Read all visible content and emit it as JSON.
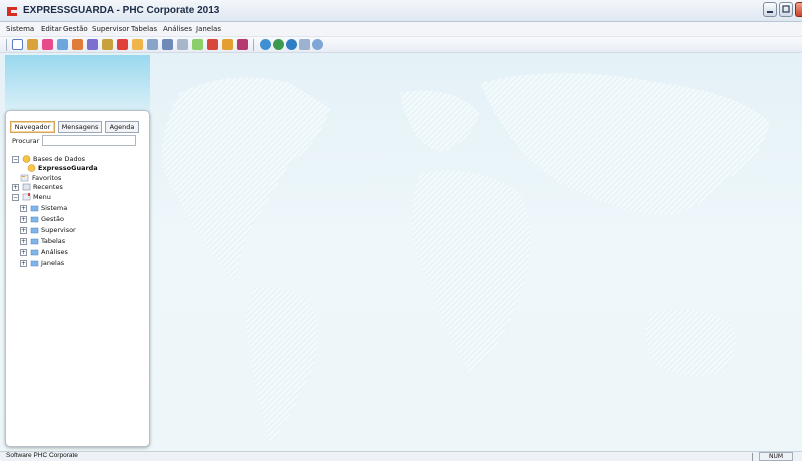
{
  "window": {
    "title": "EXPRESSGUARDA - PHC Corporate 2013",
    "logo_icon": "phc-logo-icon",
    "controls": [
      "minimize-icon",
      "maximize-icon",
      "close-icon"
    ]
  },
  "menubar": {
    "items": [
      "Sistema",
      "Editar",
      "Gestão",
      "Supervisor",
      "Tabelas",
      "Análises",
      "Janelas"
    ]
  },
  "toolbar": {
    "icons": [
      "new-doc-icon",
      "users-icon",
      "calendar-icon",
      "arrow-icon",
      "chart-icon",
      "notes-icon",
      "users-icon",
      "calendar-red-icon",
      "arrow-icon",
      "table-icon",
      "grid-icon",
      "list-icon",
      "check-icon",
      "folder-icon",
      "people-icon",
      "tools-icon",
      "globe-icon",
      "globe-icon",
      "globe-icon",
      "document-icon",
      "help-icon"
    ]
  },
  "navigator": {
    "tabs": [
      "Navegador",
      "Mensagens",
      "Agenda"
    ],
    "search_label": "Procurar :",
    "search_value": "",
    "search_hint": "",
    "tree": {
      "databases": "Bases de Dados",
      "database_selected": "ExpressoGuarda",
      "favorites": "Favoritos",
      "recent": "Recentes",
      "menu": "Menu",
      "menu_children": [
        "Sistema",
        "Gestão",
        "Supervisor",
        "Tabelas",
        "Análises",
        "Janelas"
      ]
    }
  },
  "statusbar": {
    "text": "Software PHC Corporate",
    "num": "NUM"
  },
  "colors": {
    "accent": "#f7b74a",
    "panel_top": "#9ad8ee",
    "workspace": "#e8f4f8"
  }
}
